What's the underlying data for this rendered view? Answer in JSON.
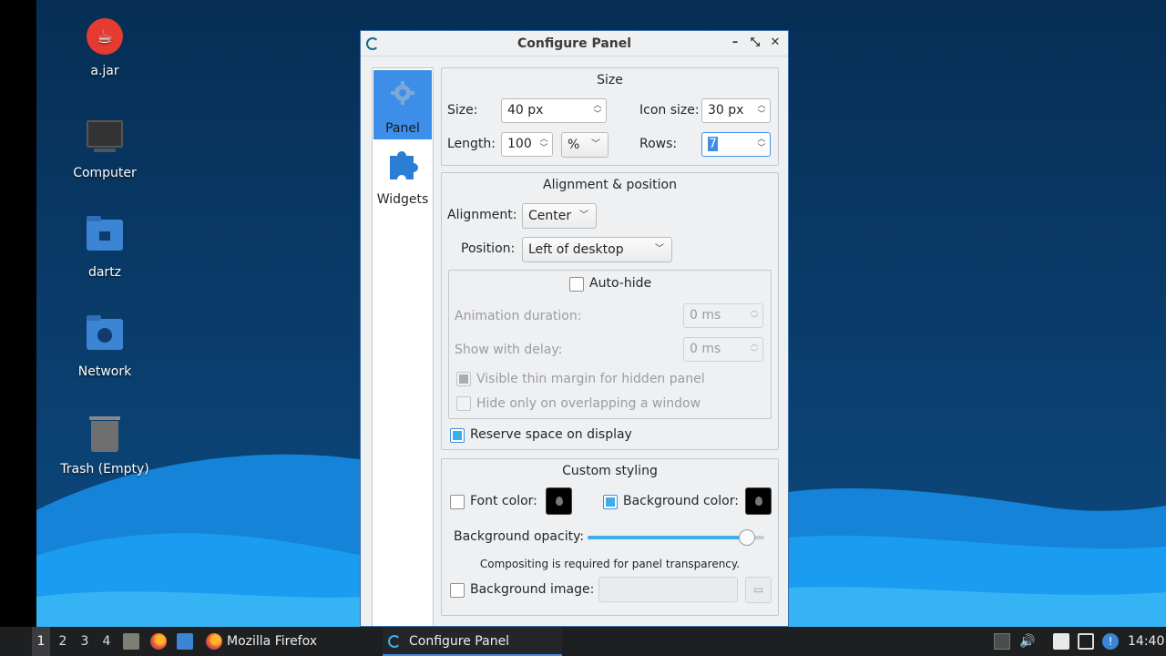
{
  "desktop": {
    "icons": [
      {
        "label": "a.jar",
        "icon": "java-jar-icon"
      },
      {
        "label": "Computer",
        "icon": "computer-icon"
      },
      {
        "label": "dartz",
        "icon": "home-folder-icon"
      },
      {
        "label": "Network",
        "icon": "network-folder-icon"
      },
      {
        "label": "Trash (Empty)",
        "icon": "trash-icon"
      }
    ]
  },
  "dialog": {
    "title": "Configure Panel",
    "sidebar": [
      {
        "label": "Panel",
        "icon": "gear-icon",
        "active": true
      },
      {
        "label": "Widgets",
        "icon": "puzzle-icon",
        "active": false
      }
    ],
    "size_group": {
      "title": "Size",
      "size_label": "Size:",
      "size_value": "40 px",
      "icon_size_label": "Icon size:",
      "icon_size_value": "30 px",
      "length_label": "Length:",
      "length_value": "100",
      "length_unit": "%",
      "rows_label": "Rows:",
      "rows_value": "7"
    },
    "align_group": {
      "title": "Alignment & position",
      "alignment_label": "Alignment:",
      "alignment_value": "Center",
      "position_label": "Position:",
      "position_value": "Left of desktop",
      "autohide_label": "Auto-hide",
      "anim_label": "Animation duration:",
      "anim_value": "0 ms",
      "delay_label": "Show with delay:",
      "delay_value": "0 ms",
      "thin_margin_label": "Visible thin margin for hidden panel",
      "overlap_label": "Hide only on overlapping a window",
      "reserve_label": "Reserve space on display"
    },
    "style_group": {
      "title": "Custom styling",
      "font_color_label": "Font color:",
      "bg_color_label": "Background color:",
      "bg_opacity_label": "Background opacity:",
      "bg_opacity": 0.9,
      "compositing_note": "Compositing is required for panel transparency.",
      "bg_image_label": "Background image:"
    },
    "colors": {
      "accent": "#3d8ee8",
      "check": "#3daee9"
    }
  },
  "taskbar": {
    "workspaces": [
      "1",
      "2",
      "3",
      "4"
    ],
    "active_workspace": "1",
    "tasks": [
      {
        "label": "Mozilla Firefox",
        "icon": "firefox-icon"
      },
      {
        "label": "Configure Panel",
        "icon": "configure-icon",
        "active": true
      }
    ],
    "clock": "14:40"
  }
}
